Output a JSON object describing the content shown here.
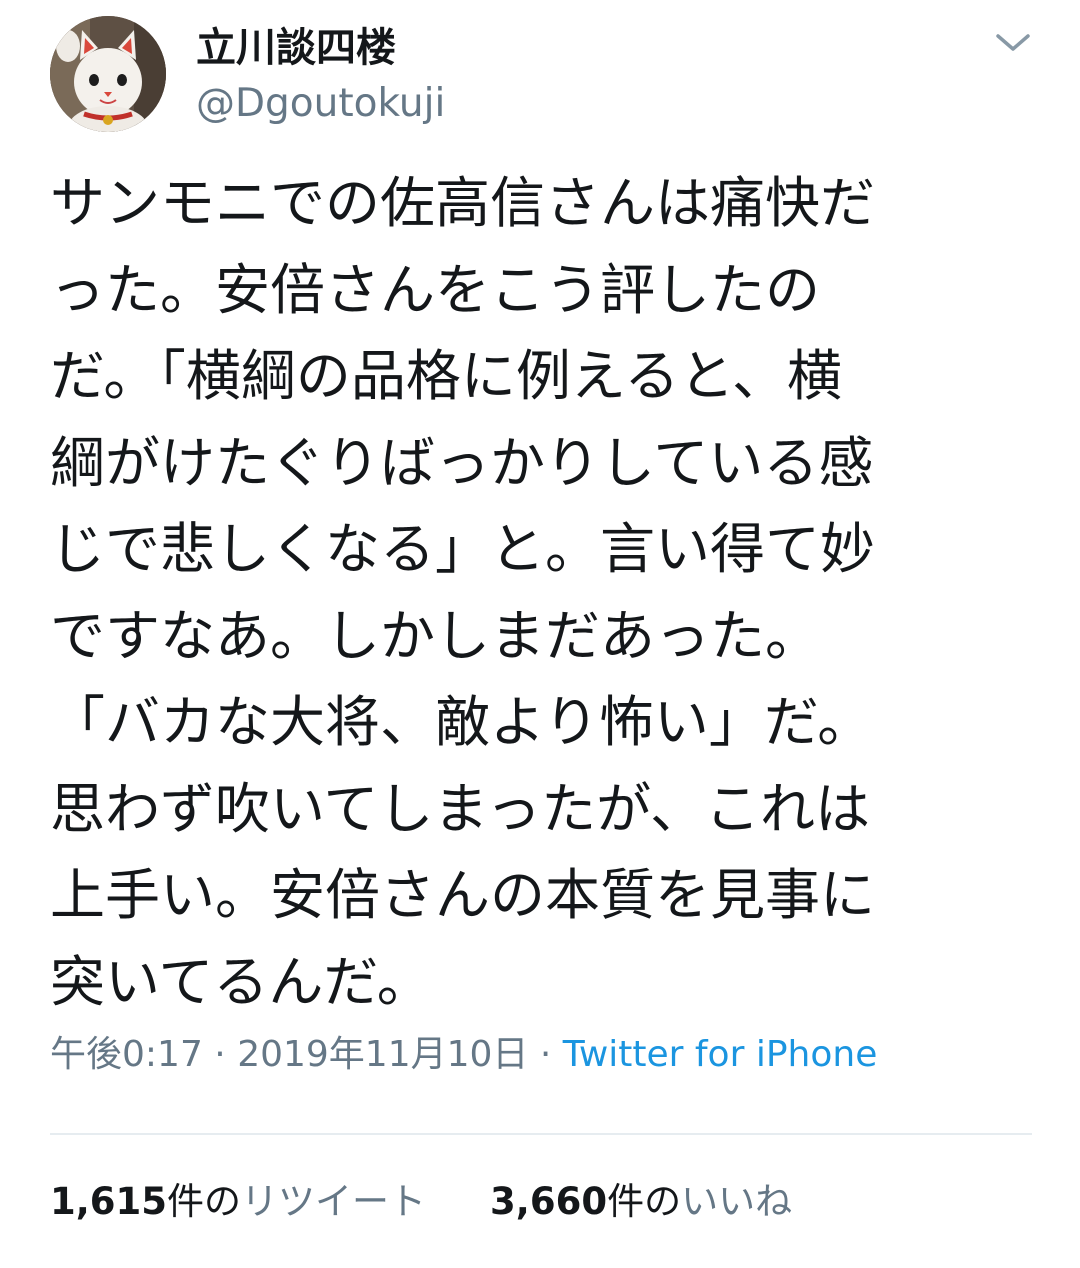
{
  "author": {
    "display_name": "立川談四楼",
    "handle": "@Dgoutokuji",
    "avatar_icon": "maneki-neko-avatar"
  },
  "menu_icon": "chevron-down-icon",
  "tweet": {
    "lines": [
      "サンモニでの佐高信さんは痛快だ",
      "った。安倍さんをこう評したの",
      "だ。「横綱の品格に例えると、横",
      "綱がけたぐりばっかりしている感",
      "じで悲しくなる」と。言い得て妙",
      "ですなあ。しかしまだあった。",
      "「バカな大将、敵より怖い」だ。",
      "思わず吹いてしまったが、これは",
      "上手い。安倍さんの本質を見事に",
      "突いてるんだ。"
    ]
  },
  "meta": {
    "time": "午後0:17",
    "separator": " · ",
    "date": "2019年11月10日",
    "source": "Twitter for iPhone"
  },
  "stats": {
    "retweets": {
      "count": "1,615",
      "unit": "件の",
      "label": "リツイート"
    },
    "likes": {
      "count": "3,660",
      "unit": "件の",
      "label": "いいね"
    }
  },
  "colors": {
    "text": "#14171a",
    "secondary": "#657786",
    "link": "#1b95e0",
    "divider": "#e6ecf0"
  }
}
